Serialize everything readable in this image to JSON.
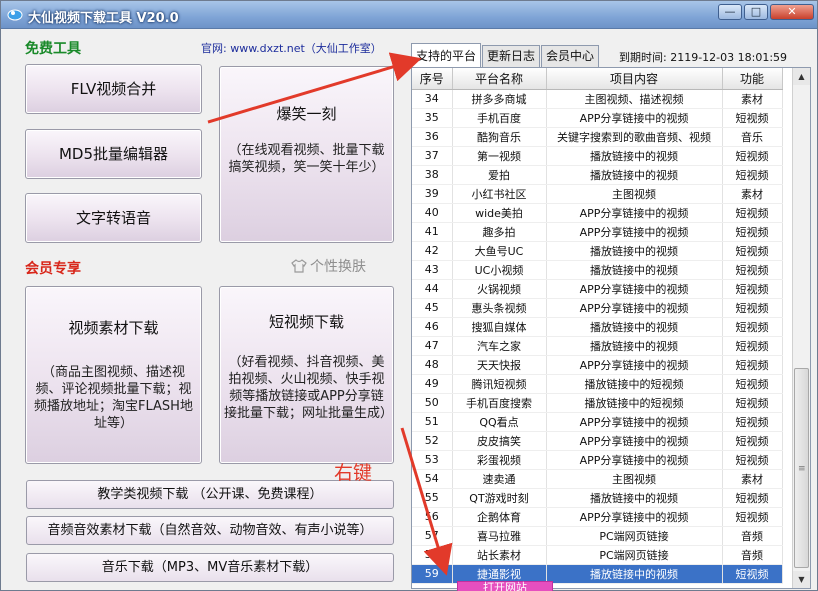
{
  "window": {
    "title": "大仙视频下载工具 V20.0",
    "min_icon": "—",
    "max_icon": "□",
    "close_icon": "✕"
  },
  "left": {
    "free_title": "免费工具",
    "site_label": "官网: www.dxzt.net（大仙工作室）",
    "buttons": {
      "flv": "FLV视频合并",
      "md5": "MD5批量编辑器",
      "tts": "文字转语音",
      "joke_title": "爆笑一刻",
      "joke_desc": "（在线观看视频、批量下载搞笑视频，笑一笑十年少）"
    },
    "member_title": "会员专享",
    "skin_label": "个性换肤",
    "material": {
      "title": "视频素材下载",
      "desc": "（商品主图视频、描述视频、评论视频批量下载；视频播放地址；淘宝FLASH地址等）"
    },
    "short": {
      "title": "短视频下载",
      "desc": "（好看视频、抖音视频、美拍视频、火山视频、快手视频等播放链接或APP分享链接批量下载；网址批量生成）"
    },
    "wide": [
      "教学类视频下载 （公开课、免费课程）",
      "音频音效素材下载（自然音效、动物音效、有声小说等）",
      "音乐下载（MP3、MV音乐素材下载）"
    ]
  },
  "tabs": [
    "支持的平台",
    "更新日志",
    "会员中心"
  ],
  "expire": "到期时间: 2119-12-03 18:01:59",
  "table": {
    "columns": [
      "序号",
      "平台名称",
      "项目内容",
      "功能"
    ],
    "rows": [
      [
        "34",
        "拼多多商城",
        "主图视频、描述视频",
        "素材"
      ],
      [
        "35",
        "手机百度",
        "APP分享链接中的视频",
        "短视频"
      ],
      [
        "36",
        "酷狗音乐",
        "关键字搜索到的歌曲音频、视频",
        "音乐"
      ],
      [
        "37",
        "第一视频",
        "播放链接中的视频",
        "短视频"
      ],
      [
        "38",
        "爱拍",
        "播放链接中的视频",
        "短视频"
      ],
      [
        "39",
        "小红书社区",
        "主图视频",
        "素材"
      ],
      [
        "40",
        "wide美拍",
        "APP分享链接中的视频",
        "短视频"
      ],
      [
        "41",
        "趣多拍",
        "APP分享链接中的视频",
        "短视频"
      ],
      [
        "42",
        "大鱼号UC",
        "播放链接中的视频",
        "短视频"
      ],
      [
        "43",
        "UC小视频",
        "播放链接中的视频",
        "短视频"
      ],
      [
        "44",
        "火锅视频",
        "APP分享链接中的视频",
        "短视频"
      ],
      [
        "45",
        "惠头条视频",
        "APP分享链接中的视频",
        "短视频"
      ],
      [
        "46",
        "搜狐自媒体",
        "播放链接中的视频",
        "短视频"
      ],
      [
        "47",
        "汽车之家",
        "播放链接中的视频",
        "短视频"
      ],
      [
        "48",
        "天天快报",
        "APP分享链接中的视频",
        "短视频"
      ],
      [
        "49",
        "腾讯短视频",
        "播放链接中的短视频",
        "短视频"
      ],
      [
        "50",
        "手机百度搜索",
        "播放链接中的短视频",
        "短视频"
      ],
      [
        "51",
        "QQ看点",
        "APP分享链接中的视频",
        "短视频"
      ],
      [
        "52",
        "皮皮搞笑",
        "APP分享链接中的视频",
        "短视频"
      ],
      [
        "53",
        "彩蛋视频",
        "APP分享链接中的视频",
        "短视频"
      ],
      [
        "54",
        "速卖通",
        "主图视频",
        "素材"
      ],
      [
        "55",
        "QT游戏时刻",
        "播放链接中的视频",
        "短视频"
      ],
      [
        "56",
        "企鹅体育",
        "APP分享链接中的视频",
        "短视频"
      ],
      [
        "57",
        "喜马拉雅",
        "PC端网页链接",
        "音频"
      ],
      [
        "58",
        "站长素材",
        "PC端网页链接",
        "音频"
      ],
      [
        "59",
        "捷通影视",
        "播放链接中的视频",
        "短视频"
      ]
    ],
    "selected_index": 25
  },
  "context_menu": {
    "item": "打开网站"
  },
  "annotation": {
    "text": "右键",
    "color": "#e23a2a"
  },
  "colors": {
    "free_title": "#1a8a2a",
    "member_title": "#d8261a",
    "site_label": "#1d2d9c",
    "selection": "#3b72c7",
    "arrow": "#e23a2a"
  }
}
